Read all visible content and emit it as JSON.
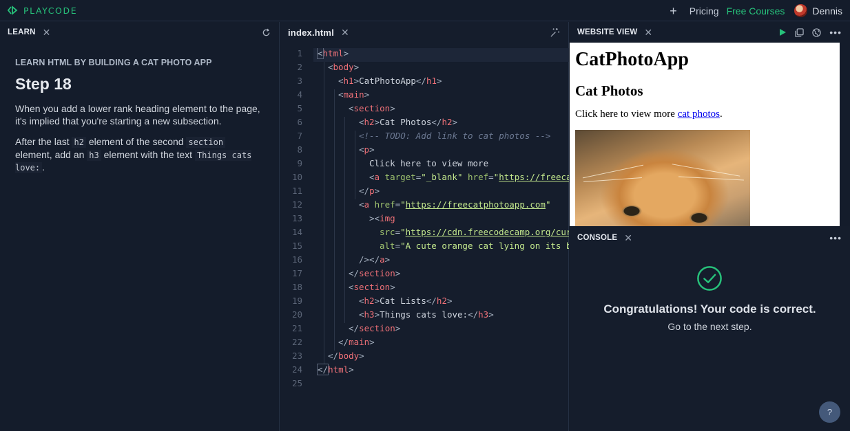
{
  "topbar": {
    "brand": "PLAYCODE",
    "pricing": "Pricing",
    "free_courses": "Free Courses",
    "user": "Dennis",
    "accent": "#27c27b"
  },
  "learn": {
    "tab": "LEARN",
    "lesson_title": "LEARN HTML BY BUILDING A CAT PHOTO APP",
    "step": "Step 18",
    "para1": "When you add a lower rank heading element to the page, it's implied that you're starting a new subsection.",
    "para2": {
      "p1": "After the last ",
      "c1": "h2",
      "p2": " element of the second ",
      "c2": "section",
      "p3": " element, add an ",
      "c3": "h3",
      "p4": " element with the text ",
      "c4": "Things cats love:",
      "p5": "."
    }
  },
  "editor": {
    "tab": "index.html",
    "lines": [
      "1",
      "2",
      "3",
      "4",
      "5",
      "6",
      "7",
      "8",
      "9",
      "10",
      "11",
      "12",
      "13",
      "14",
      "15",
      "16",
      "17",
      "18",
      "19",
      "20",
      "21",
      "22",
      "23",
      "24",
      "25"
    ],
    "code": {
      "l1": {
        "o": "<",
        "t": "html",
        "c": ">"
      },
      "l2": {
        "o": "<",
        "t": "body",
        "c": ">"
      },
      "l3": {
        "o1": "<",
        "t1": "h1",
        "c1": ">",
        "x": "CatPhotoApp",
        "o2": "</",
        "t2": "h1",
        "c2": ">"
      },
      "l4": {
        "o": "<",
        "t": "main",
        "c": ">"
      },
      "l5": {
        "o": "<",
        "t": "section",
        "c": ">"
      },
      "l6": {
        "o1": "<",
        "t1": "h2",
        "c1": ">",
        "x": "Cat Photos",
        "o2": "</",
        "t2": "h2",
        "c2": ">"
      },
      "l7": "<!-- TODO: Add link to cat photos -->",
      "l8": {
        "o": "<",
        "t": "p",
        "c": ">"
      },
      "l9": "Click here to view more",
      "l10": {
        "o": "<",
        "t": "a",
        "a1": " target",
        "eq1": "=",
        "v1": "\"_blank\"",
        "a2": " href",
        "eq2": "=",
        "q": "\"",
        "u": "https://freeca"
      },
      "l11": {
        "o": "</",
        "t": "p",
        "c": ">"
      },
      "l12": {
        "o": "<",
        "t": "a",
        "a": " href",
        "eq": "=",
        "q1": "\"",
        "u": "https://freecatphotoapp.com",
        "q2": "\""
      },
      "l13": {
        "o": "><",
        "t": "img"
      },
      "l14": {
        "a": "src",
        "eq": "=",
        "q": "\"",
        "u": "https://cdn.freecodecamp.org/cur"
      },
      "l15": {
        "a": "alt",
        "eq": "=",
        "v": "\"A cute orange cat lying on its b"
      },
      "l16": {
        "o": "/></",
        "t": "a",
        "c": ">"
      },
      "l17": {
        "o": "</",
        "t": "section",
        "c": ">"
      },
      "l18": {
        "o": "<",
        "t": "section",
        "c": ">"
      },
      "l19": {
        "o1": "<",
        "t1": "h2",
        "c1": ">",
        "x": "Cat Lists",
        "o2": "</",
        "t2": "h2",
        "c2": ">"
      },
      "l20": {
        "o1": "<",
        "t1": "h3",
        "c1": ">",
        "x": "Things cats love:",
        "o2": "</",
        "t2": "h3",
        "c2": ">"
      },
      "l21": {
        "o": "</",
        "t": "section",
        "c": ">"
      },
      "l22": {
        "o": "</",
        "t": "main",
        "c": ">"
      },
      "l23": {
        "o": "</",
        "t": "body",
        "c": ">"
      },
      "l24": {
        "o": "</",
        "t": "html",
        "c": ">"
      }
    }
  },
  "preview": {
    "tab": "WEBSITE VIEW",
    "h1": "CatPhotoApp",
    "h2": "Cat Photos",
    "p_text": "Click here to view more ",
    "link": "cat photos",
    "p_end": "."
  },
  "console": {
    "tab": "CONSOLE",
    "message": "Congratulations! Your code is correct.",
    "next": "Go to the next step.",
    "help": "?",
    "success_color": "#27c27b"
  }
}
